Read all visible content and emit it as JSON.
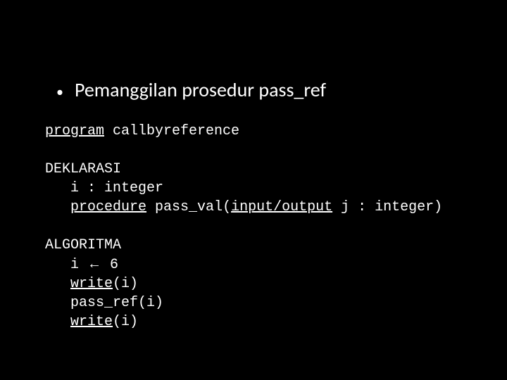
{
  "bullet": {
    "dot": "•",
    "text": "Pemanggilan prosedur pass_ref"
  },
  "code": {
    "l1a": "program",
    "l1b": " callbyreference",
    "blank1": "",
    "l2": "DEKLARASI",
    "l3": "   i : integer",
    "l4a": "   ",
    "l4b": "procedure",
    "l4c": " pass_val(",
    "l4d": "input/output",
    "l4e": " j : integer)",
    "blank2": "",
    "l5": "ALGORITMA",
    "l6a": "   i ",
    "l6arrow": "←",
    "l6b": " 6",
    "l7a": "   ",
    "l7b": "write",
    "l7c": "(i)",
    "l8": "   pass_ref(i)",
    "l9a": "   ",
    "l9b": "write",
    "l9c": "(i)"
  }
}
